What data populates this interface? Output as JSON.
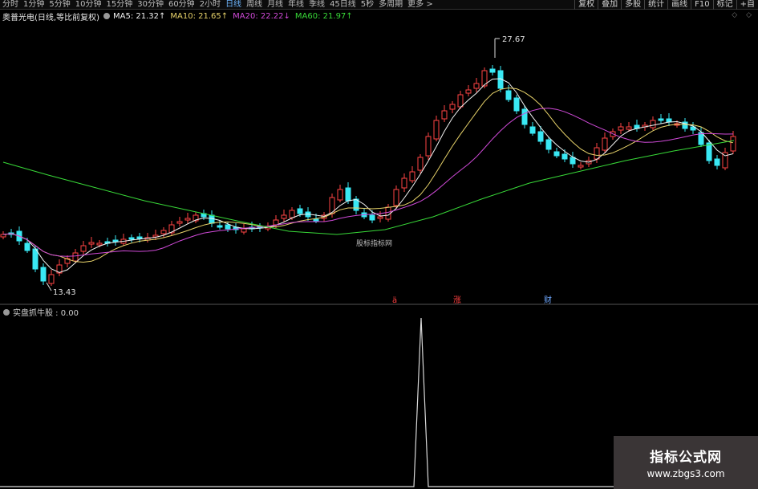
{
  "toolbar": {
    "periods": [
      "分时",
      "1分钟",
      "5分钟",
      "10分钟",
      "15分钟",
      "30分钟",
      "60分钟",
      "2小时",
      "日线",
      "周线",
      "月线",
      "年线",
      "季线",
      "45日线",
      "5秒",
      "多周期",
      "更多 >"
    ],
    "active_period": "日线",
    "tools": [
      "复权",
      "叠加",
      "多股",
      "统计",
      "画线",
      "F10",
      "标记",
      "+自"
    ]
  },
  "info_bar": {
    "stock_name": "奥普光电(日线,等比前复权)",
    "ma": [
      {
        "label": "MA5: 21.32",
        "arrow": "↑",
        "color": "#f2f2f2"
      },
      {
        "label": "MA10: 21.65",
        "arrow": "↑",
        "color": "#e8d36a"
      },
      {
        "label": "MA20: 22.22",
        "arrow": "↓",
        "color": "#d04ad8"
      },
      {
        "label": "MA60: 21.97",
        "arrow": "↑",
        "color": "#38d938"
      }
    ],
    "corner_icons": "◇ ◇"
  },
  "annotations": {
    "high_label": "27.67",
    "low_label": "13.43",
    "watermark": "股标指标网",
    "markers": [
      {
        "text": "ä",
        "color": "#ff4040"
      },
      {
        "text": "涨",
        "color": "#ff4040"
      },
      {
        "text": "财",
        "color": "#6fa8ff"
      }
    ]
  },
  "sub_indicator": {
    "label": "实盘抓牛股 : 0.00"
  },
  "logo": {
    "title": "指标公式网",
    "url": "www.zbgs3.com"
  },
  "colors": {
    "up": "#ff4545",
    "down": "#39e8f4",
    "ma5": "#f2f2f2",
    "ma10": "#e8d36a",
    "ma20": "#d04ad8",
    "ma60": "#38d938"
  }
}
